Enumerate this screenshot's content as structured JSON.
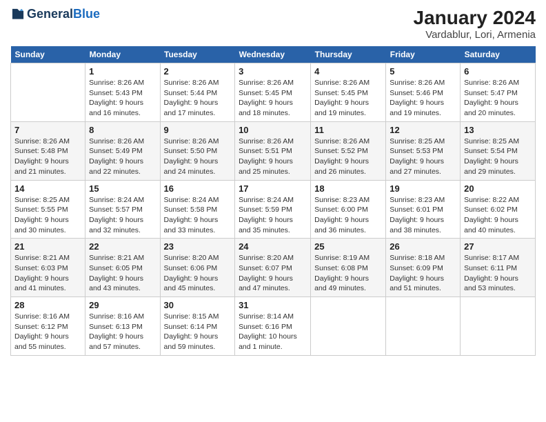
{
  "header": {
    "logo_line1": "General",
    "logo_line2": "Blue",
    "title": "January 2024",
    "subtitle": "Vardablur, Lori, Armenia"
  },
  "days_of_week": [
    "Sunday",
    "Monday",
    "Tuesday",
    "Wednesday",
    "Thursday",
    "Friday",
    "Saturday"
  ],
  "weeks": [
    [
      {
        "day": "",
        "sunrise": "",
        "sunset": "",
        "daylight": ""
      },
      {
        "day": "1",
        "sunrise": "Sunrise: 8:26 AM",
        "sunset": "Sunset: 5:43 PM",
        "daylight": "Daylight: 9 hours and 16 minutes."
      },
      {
        "day": "2",
        "sunrise": "Sunrise: 8:26 AM",
        "sunset": "Sunset: 5:44 PM",
        "daylight": "Daylight: 9 hours and 17 minutes."
      },
      {
        "day": "3",
        "sunrise": "Sunrise: 8:26 AM",
        "sunset": "Sunset: 5:45 PM",
        "daylight": "Daylight: 9 hours and 18 minutes."
      },
      {
        "day": "4",
        "sunrise": "Sunrise: 8:26 AM",
        "sunset": "Sunset: 5:45 PM",
        "daylight": "Daylight: 9 hours and 19 minutes."
      },
      {
        "day": "5",
        "sunrise": "Sunrise: 8:26 AM",
        "sunset": "Sunset: 5:46 PM",
        "daylight": "Daylight: 9 hours and 19 minutes."
      },
      {
        "day": "6",
        "sunrise": "Sunrise: 8:26 AM",
        "sunset": "Sunset: 5:47 PM",
        "daylight": "Daylight: 9 hours and 20 minutes."
      }
    ],
    [
      {
        "day": "7",
        "sunrise": "Sunrise: 8:26 AM",
        "sunset": "Sunset: 5:48 PM",
        "daylight": "Daylight: 9 hours and 21 minutes."
      },
      {
        "day": "8",
        "sunrise": "Sunrise: 8:26 AM",
        "sunset": "Sunset: 5:49 PM",
        "daylight": "Daylight: 9 hours and 22 minutes."
      },
      {
        "day": "9",
        "sunrise": "Sunrise: 8:26 AM",
        "sunset": "Sunset: 5:50 PM",
        "daylight": "Daylight: 9 hours and 24 minutes."
      },
      {
        "day": "10",
        "sunrise": "Sunrise: 8:26 AM",
        "sunset": "Sunset: 5:51 PM",
        "daylight": "Daylight: 9 hours and 25 minutes."
      },
      {
        "day": "11",
        "sunrise": "Sunrise: 8:26 AM",
        "sunset": "Sunset: 5:52 PM",
        "daylight": "Daylight: 9 hours and 26 minutes."
      },
      {
        "day": "12",
        "sunrise": "Sunrise: 8:25 AM",
        "sunset": "Sunset: 5:53 PM",
        "daylight": "Daylight: 9 hours and 27 minutes."
      },
      {
        "day": "13",
        "sunrise": "Sunrise: 8:25 AM",
        "sunset": "Sunset: 5:54 PM",
        "daylight": "Daylight: 9 hours and 29 minutes."
      }
    ],
    [
      {
        "day": "14",
        "sunrise": "Sunrise: 8:25 AM",
        "sunset": "Sunset: 5:55 PM",
        "daylight": "Daylight: 9 hours and 30 minutes."
      },
      {
        "day": "15",
        "sunrise": "Sunrise: 8:24 AM",
        "sunset": "Sunset: 5:57 PM",
        "daylight": "Daylight: 9 hours and 32 minutes."
      },
      {
        "day": "16",
        "sunrise": "Sunrise: 8:24 AM",
        "sunset": "Sunset: 5:58 PM",
        "daylight": "Daylight: 9 hours and 33 minutes."
      },
      {
        "day": "17",
        "sunrise": "Sunrise: 8:24 AM",
        "sunset": "Sunset: 5:59 PM",
        "daylight": "Daylight: 9 hours and 35 minutes."
      },
      {
        "day": "18",
        "sunrise": "Sunrise: 8:23 AM",
        "sunset": "Sunset: 6:00 PM",
        "daylight": "Daylight: 9 hours and 36 minutes."
      },
      {
        "day": "19",
        "sunrise": "Sunrise: 8:23 AM",
        "sunset": "Sunset: 6:01 PM",
        "daylight": "Daylight: 9 hours and 38 minutes."
      },
      {
        "day": "20",
        "sunrise": "Sunrise: 8:22 AM",
        "sunset": "Sunset: 6:02 PM",
        "daylight": "Daylight: 9 hours and 40 minutes."
      }
    ],
    [
      {
        "day": "21",
        "sunrise": "Sunrise: 8:21 AM",
        "sunset": "Sunset: 6:03 PM",
        "daylight": "Daylight: 9 hours and 41 minutes."
      },
      {
        "day": "22",
        "sunrise": "Sunrise: 8:21 AM",
        "sunset": "Sunset: 6:05 PM",
        "daylight": "Daylight: 9 hours and 43 minutes."
      },
      {
        "day": "23",
        "sunrise": "Sunrise: 8:20 AM",
        "sunset": "Sunset: 6:06 PM",
        "daylight": "Daylight: 9 hours and 45 minutes."
      },
      {
        "day": "24",
        "sunrise": "Sunrise: 8:20 AM",
        "sunset": "Sunset: 6:07 PM",
        "daylight": "Daylight: 9 hours and 47 minutes."
      },
      {
        "day": "25",
        "sunrise": "Sunrise: 8:19 AM",
        "sunset": "Sunset: 6:08 PM",
        "daylight": "Daylight: 9 hours and 49 minutes."
      },
      {
        "day": "26",
        "sunrise": "Sunrise: 8:18 AM",
        "sunset": "Sunset: 6:09 PM",
        "daylight": "Daylight: 9 hours and 51 minutes."
      },
      {
        "day": "27",
        "sunrise": "Sunrise: 8:17 AM",
        "sunset": "Sunset: 6:11 PM",
        "daylight": "Daylight: 9 hours and 53 minutes."
      }
    ],
    [
      {
        "day": "28",
        "sunrise": "Sunrise: 8:16 AM",
        "sunset": "Sunset: 6:12 PM",
        "daylight": "Daylight: 9 hours and 55 minutes."
      },
      {
        "day": "29",
        "sunrise": "Sunrise: 8:16 AM",
        "sunset": "Sunset: 6:13 PM",
        "daylight": "Daylight: 9 hours and 57 minutes."
      },
      {
        "day": "30",
        "sunrise": "Sunrise: 8:15 AM",
        "sunset": "Sunset: 6:14 PM",
        "daylight": "Daylight: 9 hours and 59 minutes."
      },
      {
        "day": "31",
        "sunrise": "Sunrise: 8:14 AM",
        "sunset": "Sunset: 6:16 PM",
        "daylight": "Daylight: 10 hours and 1 minute."
      },
      {
        "day": "",
        "sunrise": "",
        "sunset": "",
        "daylight": ""
      },
      {
        "day": "",
        "sunrise": "",
        "sunset": "",
        "daylight": ""
      },
      {
        "day": "",
        "sunrise": "",
        "sunset": "",
        "daylight": ""
      }
    ]
  ]
}
